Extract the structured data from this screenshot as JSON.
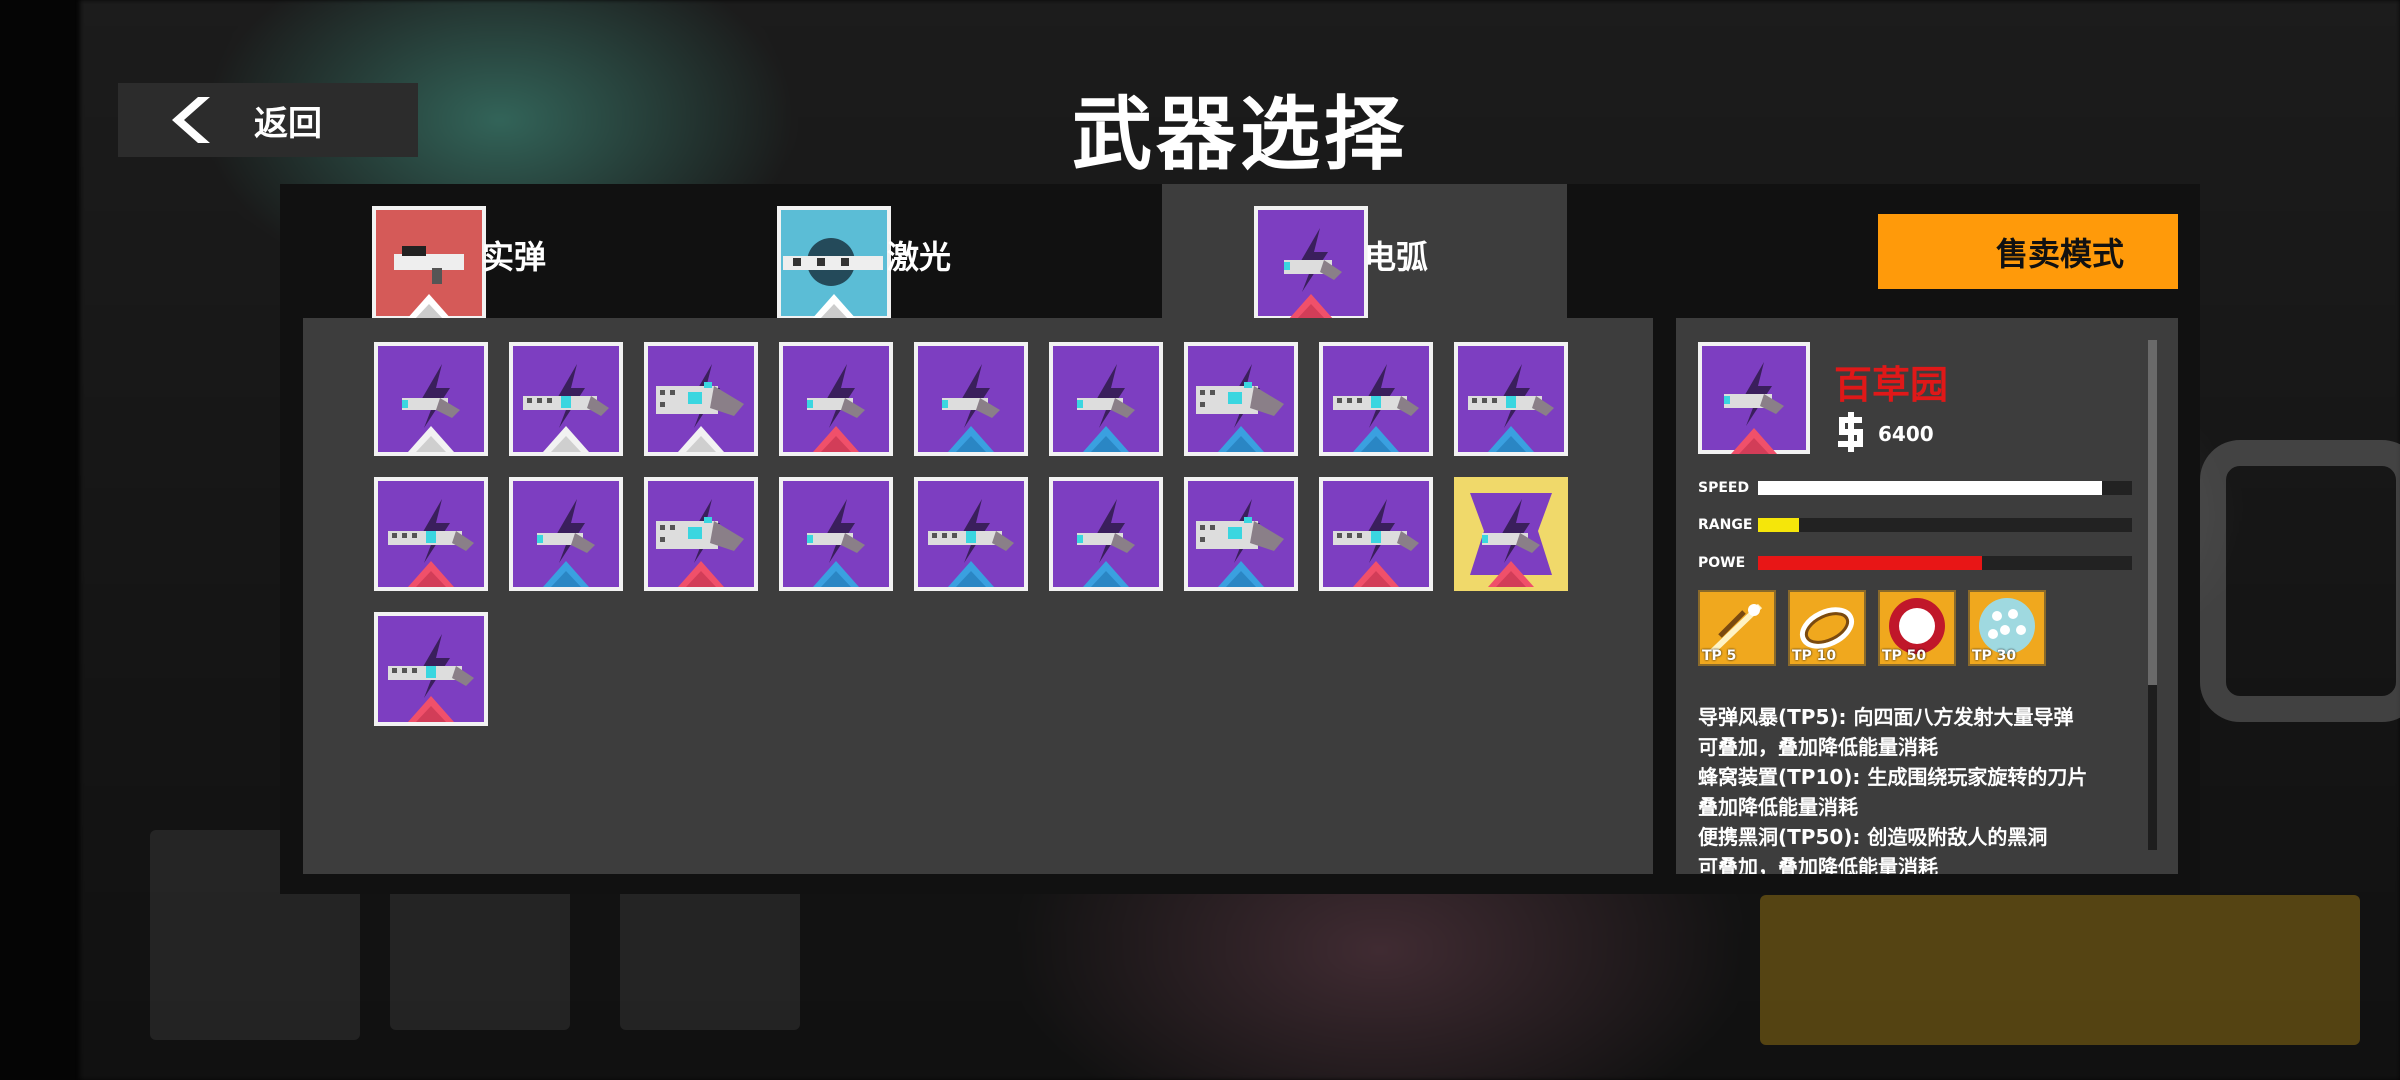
{
  "header": {
    "back_label": "返回",
    "title": "武器选择"
  },
  "tabs": [
    {
      "label": "实弹",
      "color": "#d55a58",
      "active": false
    },
    {
      "label": "激光",
      "color": "#5bbdd6",
      "active": false
    },
    {
      "label": "电弧",
      "color": "#7d3ec1",
      "active": true
    }
  ],
  "sell_button": "售卖模式",
  "items": [
    {
      "icon": "arc-pistol-icon",
      "rarity": "white"
    },
    {
      "icon": "arc-rifle-icon",
      "rarity": "white"
    },
    {
      "icon": "arc-cannon-icon",
      "rarity": "white"
    },
    {
      "icon": "arc-pistol-icon",
      "rarity": "red"
    },
    {
      "icon": "arc-pistol-icon",
      "rarity": "blue"
    },
    {
      "icon": "arc-pistol-icon",
      "rarity": "blue"
    },
    {
      "icon": "arc-cannon-icon",
      "rarity": "blue"
    },
    {
      "icon": "arc-rifle-icon",
      "rarity": "blue"
    },
    {
      "icon": "arc-rifle-icon",
      "rarity": "blue"
    },
    {
      "icon": "arc-rifle-icon",
      "rarity": "red"
    },
    {
      "icon": "arc-pistol-icon",
      "rarity": "blue"
    },
    {
      "icon": "arc-cannon-icon",
      "rarity": "red"
    },
    {
      "icon": "arc-pistol-icon",
      "rarity": "blue"
    },
    {
      "icon": "arc-rifle-icon",
      "rarity": "blue"
    },
    {
      "icon": "arc-pistol-icon",
      "rarity": "blue"
    },
    {
      "icon": "arc-cannon-icon",
      "rarity": "blue"
    },
    {
      "icon": "arc-rifle-icon",
      "rarity": "red"
    },
    {
      "icon": "arc-pistol-icon",
      "rarity": "red",
      "selected": true
    },
    {
      "icon": "arc-rifle-icon",
      "rarity": "red"
    }
  ],
  "rarity_colors": {
    "white": "#f2f2f2",
    "red": "#f0506a",
    "blue": "#3aa0e0"
  },
  "detail": {
    "name": "百草园",
    "price": "6400",
    "stats": [
      {
        "label": "SPEED",
        "value": 0.92,
        "color": "#ffffff"
      },
      {
        "label": "RANGE",
        "value": 0.11,
        "color": "#f5e60a"
      },
      {
        "label": "POWE",
        "value": 0.6,
        "color": "#e81616"
      }
    ],
    "skills": [
      {
        "icon": "missile-storm-icon",
        "tp": "TP 5"
      },
      {
        "icon": "blade-hive-icon",
        "tp": "TP 10"
      },
      {
        "icon": "black-hole-icon",
        "tp": "TP 50"
      },
      {
        "icon": "shield-orb-icon",
        "tp": "TP 30"
      }
    ],
    "description": [
      "导弹风暴(TP5): 向四面八方发射大量导弹",
      "可叠加，叠加降低能量消耗",
      "蜂窝装置(TP10): 生成围绕玩家旋转的刀片",
      "叠加降低能量消耗",
      "便携黑洞(TP50): 创造吸附敌人的黑洞",
      "可叠加，叠加降低能量消耗"
    ]
  }
}
